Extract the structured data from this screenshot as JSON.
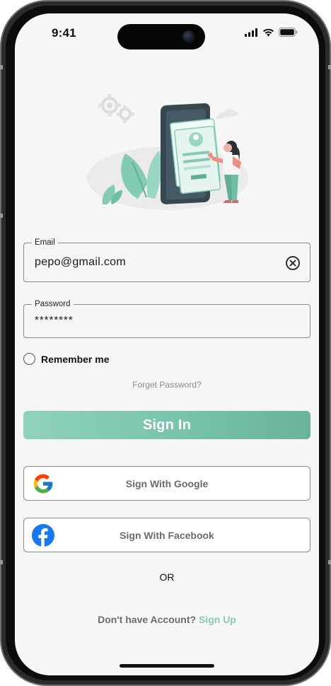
{
  "status_bar": {
    "time": "9:41",
    "icons": [
      "cellular-signal-icon",
      "wifi-icon",
      "battery-icon"
    ]
  },
  "illustration": {
    "name": "login-illustration",
    "palette": {
      "accent": "#84cbb4",
      "dark": "#37474f",
      "light": "#e6f4ef"
    }
  },
  "email": {
    "label": "Email",
    "value": "pepo@gmail.com"
  },
  "password": {
    "label": "Password",
    "value": "********"
  },
  "remember": {
    "label": "Remember me",
    "checked": false
  },
  "forgot_password": "Forget Password?",
  "sign_in_label": "Sign In",
  "social": {
    "google_label": "Sign With Google",
    "facebook_label": "Sign With Facebook"
  },
  "or_label": "OR",
  "signup": {
    "prompt": "Don't have Account?",
    "link": "Sign Up"
  },
  "colors": {
    "accent": "#84cbb4",
    "button_gradient_start": "#8fd2bd",
    "button_gradient_end": "#69b39d",
    "background": "#f6f6f6",
    "facebook_blue": "#1877f2"
  }
}
